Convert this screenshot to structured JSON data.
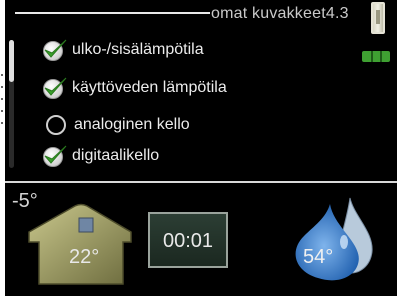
{
  "header": {
    "title": "omat kuvakkeet",
    "page_number": "4.3"
  },
  "options": [
    {
      "label": "ulko-/sisälämpötila",
      "checked": true
    },
    {
      "label": "käyttöveden lämpötila",
      "checked": true
    },
    {
      "label": "analoginen kello",
      "checked": false
    },
    {
      "label": "digitaalikello",
      "checked": true
    }
  ],
  "status": {
    "outdoor_temp": "-5°",
    "indoor_temp": "22°",
    "clock": "00:01",
    "hot_water_temp": "54°"
  },
  "colors": {
    "check_green": "#3aa12c",
    "drop_blue": "#2f7fd1",
    "house_olive": "#9b9a5f"
  }
}
